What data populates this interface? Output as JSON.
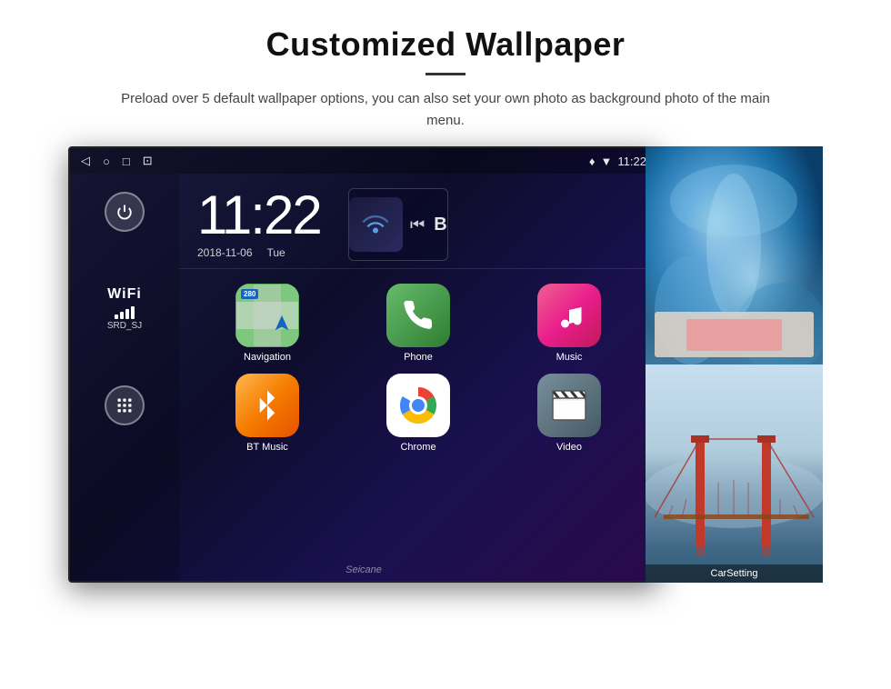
{
  "header": {
    "title": "Customized Wallpaper",
    "subtitle": "Preload over 5 default wallpaper options, you can also set your own photo as background photo of the main menu.",
    "title_divider": true
  },
  "device": {
    "status_bar": {
      "back_icon": "◁",
      "home_icon": "○",
      "recents_icon": "□",
      "screenshot_icon": "⊡",
      "gps_icon": "♦",
      "signal_icon": "▼",
      "time": "11:22"
    },
    "clock": {
      "time": "11:22",
      "date": "2018-11-06",
      "day": "Tue"
    },
    "sidebar": {
      "wifi_label": "WiFi",
      "wifi_ssid": "SRD_SJ",
      "apps_icon": "⠿"
    },
    "apps": [
      {
        "name": "Navigation",
        "icon_type": "nav"
      },
      {
        "name": "Phone",
        "icon_type": "phone"
      },
      {
        "name": "Music",
        "icon_type": "music"
      },
      {
        "name": "BT Music",
        "icon_type": "bt"
      },
      {
        "name": "Chrome",
        "icon_type": "chrome"
      },
      {
        "name": "Video",
        "icon_type": "video"
      }
    ],
    "nav_badge": "280",
    "watermark": "Seicane"
  },
  "wallpaper_photos": [
    {
      "type": "ice_cave",
      "label": ""
    },
    {
      "type": "bridge",
      "label": "CarSetting"
    }
  ]
}
